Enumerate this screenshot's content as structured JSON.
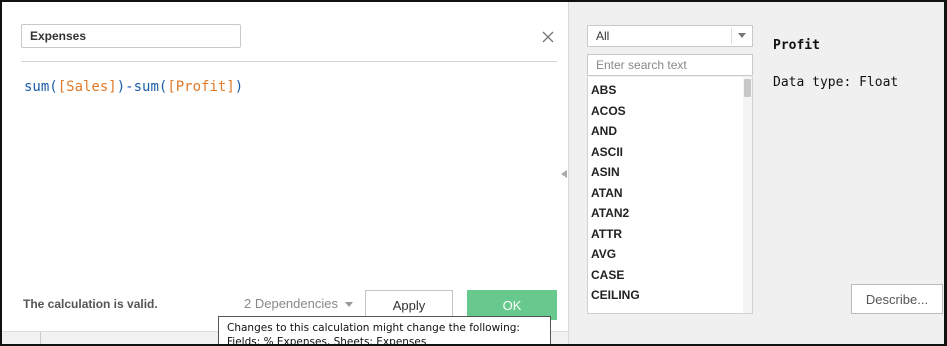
{
  "editor": {
    "calc_name": "Expenses",
    "formula": {
      "fn1": "sum(",
      "field1": "[Sales]",
      "mid": ")-sum(",
      "field2": "[Profit]",
      "end": ")"
    },
    "status": "The calculation is valid.",
    "dependencies_label": "2 Dependencies",
    "apply_label": "Apply",
    "ok_label": "OK"
  },
  "tooltip": {
    "line1": "Changes to this calculation might change the following:",
    "line2": "Fields: % Expenses,  Sheets: Expenses"
  },
  "functions": {
    "category_selected": "All",
    "search_placeholder": "Enter search text",
    "items": [
      "ABS",
      "ACOS",
      "AND",
      "ASCII",
      "ASIN",
      "ATAN",
      "ATAN2",
      "ATTR",
      "AVG",
      "CASE",
      "CEILING"
    ]
  },
  "detail": {
    "title": "Profit",
    "data_type": "Data type: Float",
    "describe_label": "Describe..."
  },
  "colors": {
    "ok_button": "#67c98d",
    "function_text": "#1b5ea8",
    "field_text": "#e07b2a"
  }
}
